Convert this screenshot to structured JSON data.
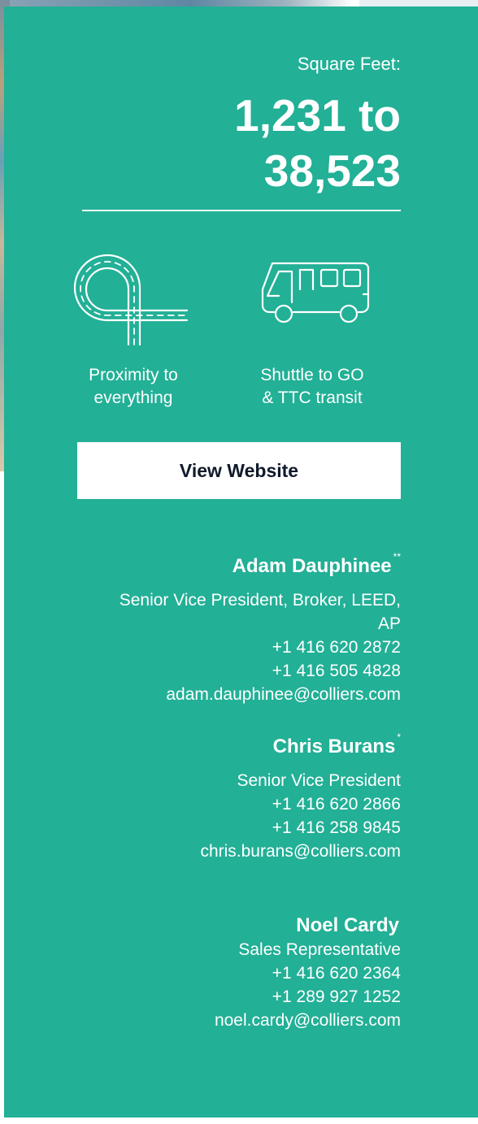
{
  "listing": {
    "square_feet_label": "Square Feet:",
    "square_feet_range_line1": "1,231 to",
    "square_feet_range_line2": "38,523"
  },
  "features": [
    {
      "icon": "road-interchange-icon",
      "label_line1": "Proximity to",
      "label_line2": "everything"
    },
    {
      "icon": "shuttle-bus-icon",
      "label_line1": "Shuttle to GO",
      "label_line2": "& TTC transit"
    }
  ],
  "cta": {
    "label": "View Website"
  },
  "contacts": [
    {
      "name": "Adam Dauphinee",
      "marker": "**",
      "title_line1": "Senior Vice President, Broker, LEED,",
      "title_line2": "AP",
      "phone1": "+1 416 620 2872",
      "phone2": "+1 416 505 4828",
      "email": "adam.dauphinee@colliers.com"
    },
    {
      "name": "Chris Burans",
      "marker": "*",
      "title_line1": "Senior Vice President",
      "phone1": "+1 416 620 2866",
      "phone2": "+1 416 258 9845",
      "email": "chris.burans@colliers.com"
    },
    {
      "name": "Noel Cardy",
      "marker": "",
      "title_line1": "Sales Representative",
      "phone1": "+1 416 620  2364",
      "phone2": "+1 289 927 1252",
      "email": "noel.cardy@colliers.com"
    }
  ],
  "colors": {
    "panel_background": "#22b096",
    "text": "#ffffff",
    "button_background": "#ffffff",
    "button_text": "#0f1a2a"
  }
}
